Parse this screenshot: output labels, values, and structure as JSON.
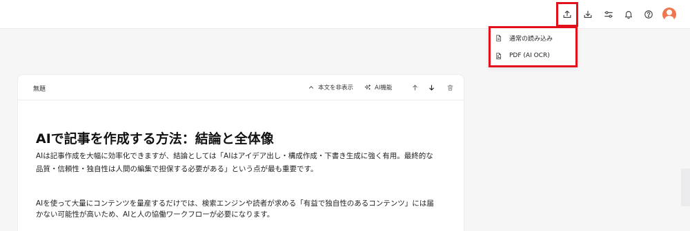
{
  "topbar": {
    "icons": [
      "upload-icon",
      "download-icon",
      "settings-sliders-icon",
      "bell-icon",
      "help-icon",
      "avatar"
    ]
  },
  "import_menu": {
    "items": [
      {
        "label": "通常の読み込み",
        "icon": "document-icon"
      },
      {
        "label": "PDF (AI OCR)",
        "icon": "image-file-icon"
      }
    ]
  },
  "card": {
    "title": "無題",
    "hide_body_label": "本文を非表示",
    "ai_features_label": "AI機能"
  },
  "document": {
    "heading": "AIで記事を作成する方法：結論と全体像",
    "paragraph1_line1": "AIは記事作成を大幅に効率化できますが、結論としては「AIはアイデア出し・構成作成・下書き生成に強く有用。最終的な",
    "paragraph1_line2": "品質・信頼性・独自性は人間の編集で担保する必要がある」という点が最も重要です。",
    "paragraph2_line1": "AIを使って大量にコンテンツを量産するだけでは、検索エンジンや読者が求める「有益で独自性のあるコンテンツ」には届",
    "paragraph2_line2": "かない可能性が高いため、AIと人の協働ワークフローが必要になります。"
  },
  "colors": {
    "highlight": "#e3101b",
    "avatar": "#f0764f",
    "background": "#f6f6f7"
  }
}
